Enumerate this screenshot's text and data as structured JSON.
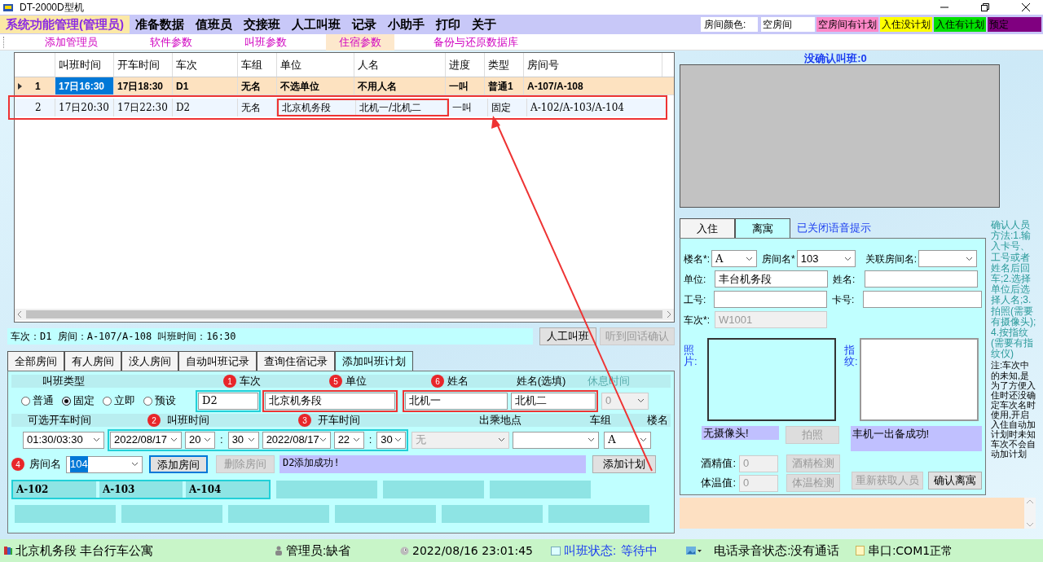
{
  "window": {
    "title": "DT-2000D型机"
  },
  "menu": [
    {
      "label": "系统功能管理(管理员)",
      "selected": true
    },
    {
      "label": "准备数据",
      "selected": false
    },
    {
      "label": "值班员",
      "selected": false
    },
    {
      "label": "交接班",
      "selected": false
    },
    {
      "label": "人工叫班",
      "selected": false
    },
    {
      "label": "记录",
      "selected": false
    },
    {
      "label": "小助手",
      "selected": false
    },
    {
      "label": "打印",
      "selected": false
    },
    {
      "label": "关于",
      "selected": false
    }
  ],
  "legend": {
    "label": "房间颜色:",
    "items": [
      {
        "label": "空房间",
        "color": "#ffffff"
      },
      {
        "label": "空房间有计划",
        "color": "#ff88c8"
      },
      {
        "label": "入住没计划",
        "color": "#ffff00"
      },
      {
        "label": "入住有计划",
        "color": "#00e000"
      },
      {
        "label": "预定",
        "color": "#800080"
      }
    ]
  },
  "toolbar": [
    {
      "label": "添加管理员",
      "selected": false
    },
    {
      "label": "软件参数",
      "selected": false
    },
    {
      "label": "叫班参数",
      "selected": false
    },
    {
      "label": "住宿参数",
      "selected": true
    },
    {
      "label": "备份与还原数据库",
      "selected": false
    }
  ],
  "table": {
    "columns": [
      "叫班时间",
      "开车时间",
      "车次",
      "车组",
      "单位",
      "人名",
      "进度",
      "类型",
      "房间号"
    ],
    "rows": [
      {
        "selected": true,
        "number": "1",
        "cells": [
          "17日16:30",
          "17日18:30",
          "D1",
          "无名",
          "不选单位",
          "不用人名",
          "一叫",
          "普通1",
          "A-107/A-108"
        ]
      },
      {
        "selected": false,
        "number": "2",
        "cells": [
          "17日20:30",
          "17日22:30",
          "D2",
          "无名",
          "北京机务段",
          "北机一/北机二",
          "一叫",
          "固定",
          "A-102/A-103/A-104"
        ]
      }
    ]
  },
  "info_line": "车次：D1 房间：A-107/A-108  叫班时间：16:30",
  "call_buttons": [
    {
      "label": "人工叫班",
      "disabled": false
    },
    {
      "label": "听到回话确认",
      "disabled": true
    }
  ],
  "tabs": [
    {
      "label": "全部房间",
      "selected": false
    },
    {
      "label": "有人房间",
      "selected": false
    },
    {
      "label": "没人房间",
      "selected": false
    },
    {
      "label": "自动叫班记录",
      "selected": false
    },
    {
      "label": "查询住宿记录",
      "selected": false
    },
    {
      "label": "添加叫班计划",
      "selected": true
    }
  ],
  "plan_form": {
    "type_label": "叫班类型",
    "radios": [
      {
        "label": "普通",
        "selected": false
      },
      {
        "label": "固定",
        "selected": true
      },
      {
        "label": "立即",
        "selected": false
      },
      {
        "label": "预设",
        "selected": false
      }
    ],
    "fields": [
      {
        "label": "车次",
        "badge": "1",
        "value": "D2"
      },
      {
        "label": "单位",
        "badge": "5",
        "value": "北京机务段"
      },
      {
        "label": "姓名",
        "badge": "6",
        "value": "北机一"
      },
      {
        "label": "姓名(选填)",
        "value": "北机二"
      },
      {
        "label": "休息时间",
        "value": "0",
        "disabled": true
      }
    ],
    "row2_labels": [
      {
        "text": "可选开车时间"
      },
      {
        "text": "叫班时间",
        "badge": "2"
      },
      {
        "text": "开车时间",
        "badge": "3"
      },
      {
        "text": "出乘地点"
      },
      {
        "text": "车组"
      },
      {
        "text": "楼名"
      }
    ],
    "departure_option": "01:30/03:30",
    "call_date": "2022/08/17",
    "call_hour": "20",
    "call_separator": ":",
    "call_minute": "30",
    "depart_date": "2022/08/17",
    "depart_hour": "22",
    "depart_separator": ":",
    "depart_minute": "30",
    "boarding_place": {
      "value": "无",
      "disabled": true
    },
    "building": "A",
    "room_label": "房间名",
    "room_badge": "4",
    "room_value": "104",
    "add_room": "添加房间",
    "delete_room": {
      "label": "删除房间",
      "disabled": true
    },
    "message": "D2添加成功!",
    "add_plan": "添加计划",
    "rooms": [
      "A-102",
      "A-103",
      "A-104"
    ]
  },
  "right": {
    "title": "没确认叫班:0",
    "tabs": [
      {
        "label": "入住",
        "selected": false
      },
      {
        "label": "离寓",
        "selected": true
      }
    ],
    "voice_hint": "已关闭语音提示",
    "building_label": "楼名*:",
    "building": "A",
    "room_label": "房间名*",
    "room": "103",
    "linked_label": "关联房间名:",
    "unit_label": "单位:",
    "unit": "丰台机务段",
    "name_label": "姓名:",
    "id_label": "工号:",
    "card_label": "卡号:",
    "train_label": "车次*:",
    "train": "W1001",
    "photo_label": "照片:",
    "fingerprint_label": "指纹:",
    "camera_message": "无摄像头!",
    "photo_button": {
      "label": "拍照",
      "disabled": true
    },
    "result_message": "丰机一出备成功!",
    "alcohol_label": "酒精值:",
    "alcohol": "0",
    "alcohol_button": {
      "label": "酒精检测",
      "disabled": true
    },
    "temp_label": "体温值:",
    "temp": "0",
    "temp_button": {
      "label": "体温检测",
      "disabled": true
    },
    "refetch_button": {
      "label": "重新获取人员",
      "disabled": true
    },
    "confirm_button": {
      "label": "确认离寓",
      "disabled": false
    },
    "method_note": "确认人员方法:1.输入卡号、工号或者姓名后回车;2.选择单位后选择人名;3.拍照(需要有摄像头);4.按指纹(需要有指纹仪)",
    "remark_note": "注:车次中的未知,是为了方便入住时还没确定车次名时使用,开启入住自动加计划时未知车次不会自动加计划"
  },
  "status_bar": {
    "location": "北京机务段 丰台行车公寓",
    "admin": "管理员:缺省",
    "datetime": "2022/08/16 23:01:45",
    "call_label": "叫班状态:",
    "call_state": "等待中",
    "phone": "电话录音状态:没有通话",
    "serial_label": "串口:",
    "serial_state": "COM1正常"
  }
}
